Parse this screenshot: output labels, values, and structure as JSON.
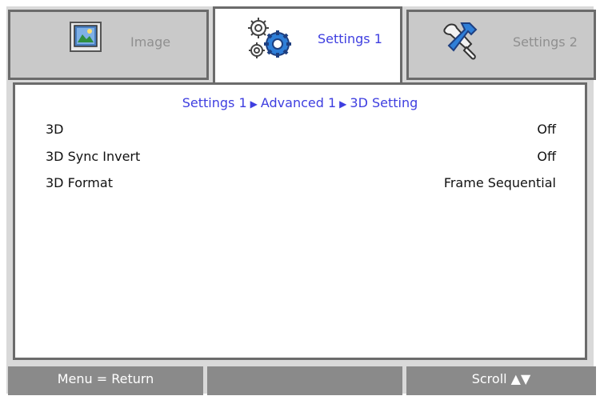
{
  "tabs": [
    {
      "label": "Image",
      "icon": "image-icon",
      "active": false
    },
    {
      "label": "Settings 1",
      "icon": "gears-icon",
      "active": true
    },
    {
      "label": "Settings 2",
      "icon": "tools-icon",
      "active": false
    }
  ],
  "breadcrumb": {
    "part1": "Settings 1",
    "part2": "Advanced 1",
    "part3": "3D Setting",
    "separator": "▶"
  },
  "rows": [
    {
      "name": "3D",
      "value": "Off"
    },
    {
      "name": "3D Sync Invert",
      "value": "Off"
    },
    {
      "name": "3D Format",
      "value": "Frame Sequential"
    }
  ],
  "footer": {
    "left": "Menu = Return",
    "middle": "",
    "right": "Scroll ▲▼"
  },
  "colors": {
    "accent": "#3e3ee0",
    "frame_bg": "#d9d9d9",
    "border": "#6b6b6b",
    "footer_bg": "#8a8a8a"
  }
}
